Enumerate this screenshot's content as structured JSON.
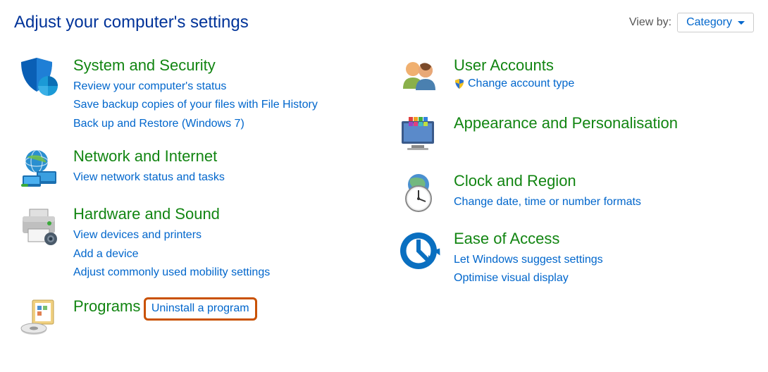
{
  "header": {
    "title": "Adjust your computer's settings",
    "viewby_label": "View by:",
    "viewby_value": "Category"
  },
  "left": [
    {
      "title": "System and Security",
      "links": [
        "Review your computer's status",
        "Save backup copies of your files with File History",
        "Back up and Restore (Windows 7)"
      ]
    },
    {
      "title": "Network and Internet",
      "links": [
        "View network status and tasks"
      ]
    },
    {
      "title": "Hardware and Sound",
      "links": [
        "View devices and printers",
        "Add a device",
        "Adjust commonly used mobility settings"
      ]
    },
    {
      "title": "Programs",
      "links": [
        "Uninstall a program"
      ]
    }
  ],
  "right": [
    {
      "title": "User Accounts",
      "links": [
        "Change account type"
      ],
      "shield": true
    },
    {
      "title": "Appearance and Personalisation",
      "links": []
    },
    {
      "title": "Clock and Region",
      "links": [
        "Change date, time or number formats"
      ]
    },
    {
      "title": "Ease of Access",
      "links": [
        "Let Windows suggest settings",
        "Optimise visual display"
      ]
    }
  ]
}
